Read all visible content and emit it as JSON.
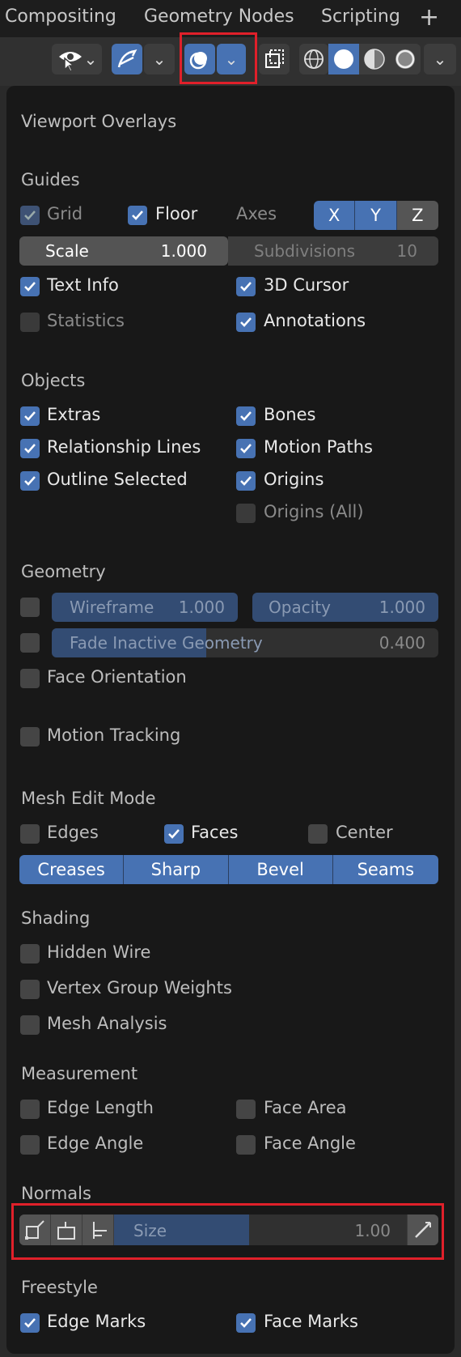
{
  "tabs": [
    "Compositing",
    "Geometry Nodes",
    "Scripting"
  ],
  "tab_add_icon": "plus-icon",
  "toolbar": {
    "icons": [
      "eye-select-icon",
      "gizmo-icon",
      "overlay-icon",
      "xray-icon",
      "wireframe-shading-icon",
      "solid-shading-icon",
      "material-shading-icon",
      "rendered-shading-icon"
    ],
    "highlight_color": "#e0202a"
  },
  "panel": {
    "title": "Viewport Overlays",
    "guides": {
      "title": "Guides",
      "grid": {
        "label": "Grid",
        "checked": true
      },
      "floor": {
        "label": "Floor",
        "checked": true
      },
      "axes_label": "Axes",
      "axes": [
        "X",
        "Y",
        "Z"
      ],
      "scale_label": "Scale",
      "scale_value": "1.000",
      "subdiv_label": "Subdivisions",
      "subdiv_value": "10",
      "text_info": {
        "label": "Text Info",
        "checked": true
      },
      "cursor": {
        "label": "3D Cursor",
        "checked": true
      },
      "statistics": {
        "label": "Statistics",
        "checked": false
      },
      "annotations": {
        "label": "Annotations",
        "checked": true
      }
    },
    "objects": {
      "title": "Objects",
      "extras": "Extras",
      "bones": "Bones",
      "relationship": "Relationship Lines",
      "motion_paths": "Motion Paths",
      "outline": "Outline Selected",
      "origins": "Origins",
      "origins_all": "Origins (All)"
    },
    "geometry": {
      "title": "Geometry",
      "wireframe_label": "Wireframe",
      "wireframe_value": "1.000",
      "opacity_label": "Opacity",
      "opacity_value": "1.000",
      "fade_label": "Fade Inactive Geometry",
      "fade_value": "0.400",
      "fade_fraction": 0.4,
      "face_orientation": "Face Orientation"
    },
    "motion_tracking": "Motion Tracking",
    "mesh_edit": {
      "title": "Mesh Edit Mode",
      "edges": "Edges",
      "faces": "Faces",
      "center": "Center",
      "buttons": [
        "Creases",
        "Sharp",
        "Bevel",
        "Seams"
      ]
    },
    "shading": {
      "title": "Shading",
      "hidden_wire": "Hidden Wire",
      "vertex_group": "Vertex Group Weights",
      "mesh_analysis": "Mesh Analysis"
    },
    "measurement": {
      "title": "Measurement",
      "edge_length": "Edge Length",
      "face_area": "Face Area",
      "edge_angle": "Edge Angle",
      "face_angle": "Face Angle"
    },
    "normals": {
      "title": "Normals",
      "size_label": "Size",
      "size_value": "1.00",
      "size_fraction": 0.46,
      "icons": [
        "vertex-normal-icon",
        "split-normal-icon",
        "face-normal-icon",
        "constant-screen-size-icon"
      ]
    },
    "freestyle": {
      "title": "Freestyle",
      "edge_marks": "Edge Marks",
      "face_marks": "Face Marks"
    }
  }
}
